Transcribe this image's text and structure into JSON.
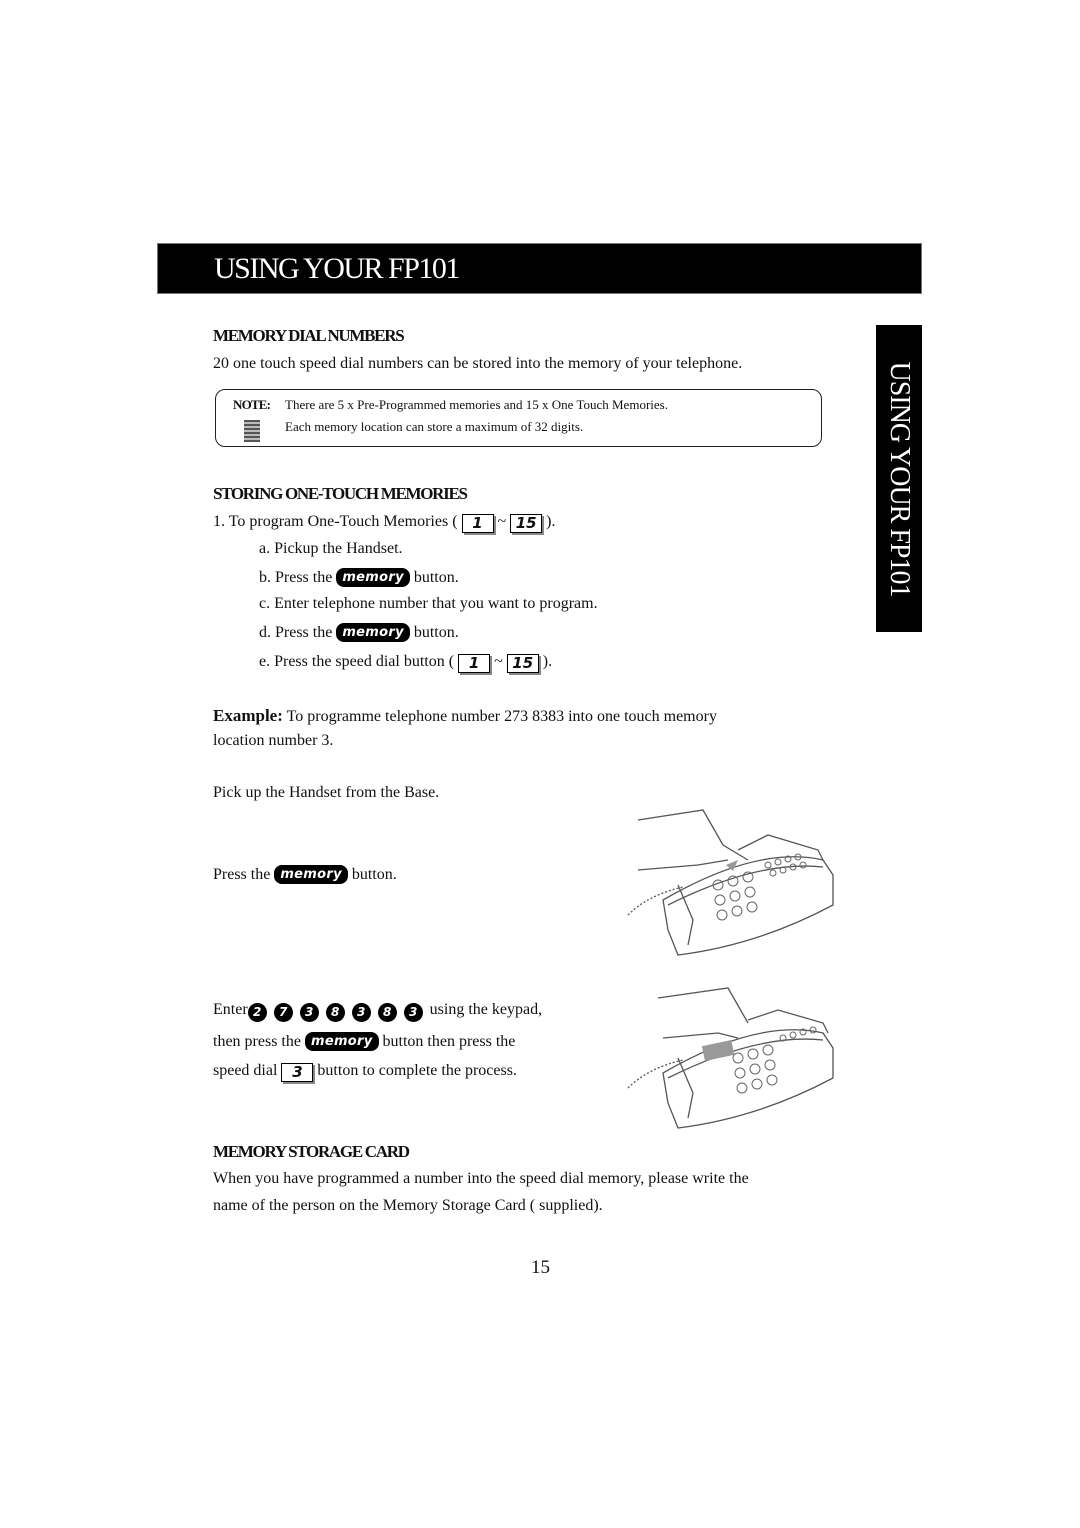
{
  "banner": {
    "title": "USING YOUR FP101"
  },
  "side_tab": {
    "label": "USING YOUR FP101"
  },
  "memory_dial": {
    "heading": "MEMORY DIAL NUMBERS",
    "intro": "20 one touch speed dial numbers can be stored into the memory of your telephone.",
    "note_label": "NOTE:",
    "note_line1": "There are 5 x Pre-Programmed memories and 15 x One Touch Memories.",
    "note_line2": "Each memory location can store a maximum of 32 digits.",
    "note_icon": "document-icon"
  },
  "storing": {
    "heading": "STORING ONE-TOUCH MEMORIES",
    "step1_prefix": "1. To program One-Touch Memories (",
    "step1_suffix": ").",
    "key_first": "1",
    "key_last": "15",
    "tilde": "~",
    "step_a": "a. Pickup the Handset.",
    "step_b_prefix": "b. Press the",
    "step_b_suffix": "button.",
    "step_c": "c. Enter telephone number that you want to program.",
    "step_d_prefix": "d. Press the",
    "step_d_suffix": "button.",
    "step_e_prefix": "e. Press the speed dial button (",
    "step_e_suffix": ")."
  },
  "memory_key_label": "memory",
  "example": {
    "label": "Example:",
    "text_line1": "To programme telephone number 273 8383 into one touch memory",
    "text_line2": "location number 3.",
    "pickup": "Pick up the Handset from the Base.",
    "press_prefix": "Press the",
    "press_suffix": "button.",
    "enter_prefix": "Enter",
    "digits": [
      "2",
      "7",
      "3",
      "8",
      "3",
      "8",
      "3"
    ],
    "enter_suffix": "using the keypad,",
    "then_prefix": "then press the",
    "then_suffix": "button then press the",
    "speed_prefix": "speed dial",
    "speed_key": "3",
    "speed_suffix": "button to complete the process."
  },
  "storage_card": {
    "heading": "MEMORY STORAGE CARD",
    "line1": "When you have programmed a number into the speed dial memory, please write the",
    "line2": "name of the person on the Memory Storage Card ( supplied)."
  },
  "page_number": "15"
}
